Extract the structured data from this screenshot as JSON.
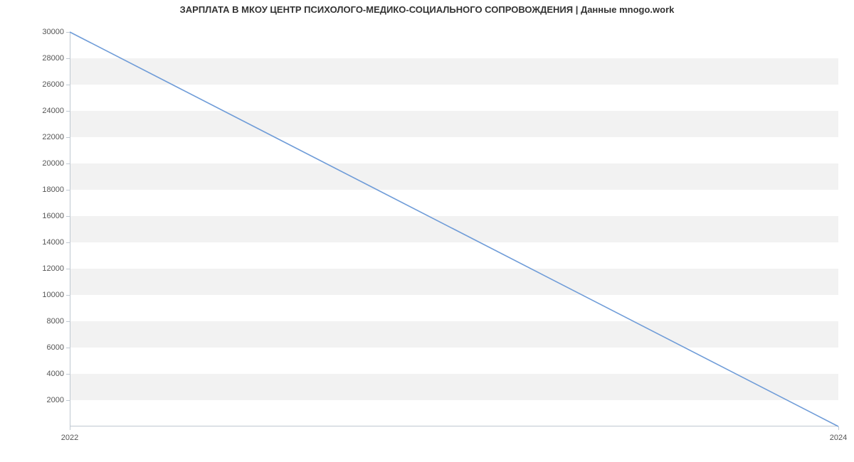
{
  "chart_data": {
    "type": "line",
    "title": "ЗАРПЛАТА В МКОУ ЦЕНТР ПСИХОЛОГО-МЕДИКО-СОЦИАЛЬНОГО СОПРОВОЖДЕНИЯ | Данные mnogo.work",
    "x": [
      2022,
      2024
    ],
    "y": [
      30000,
      0
    ],
    "x_ticks": [
      2022,
      2024
    ],
    "y_ticks": [
      2000,
      4000,
      6000,
      8000,
      10000,
      12000,
      14000,
      16000,
      18000,
      20000,
      22000,
      24000,
      26000,
      28000,
      30000
    ],
    "xlim": [
      2022,
      2024
    ],
    "ylim": [
      0,
      30000
    ],
    "line_color": "#6f9cd8",
    "band_color": "#f2f2f2"
  }
}
